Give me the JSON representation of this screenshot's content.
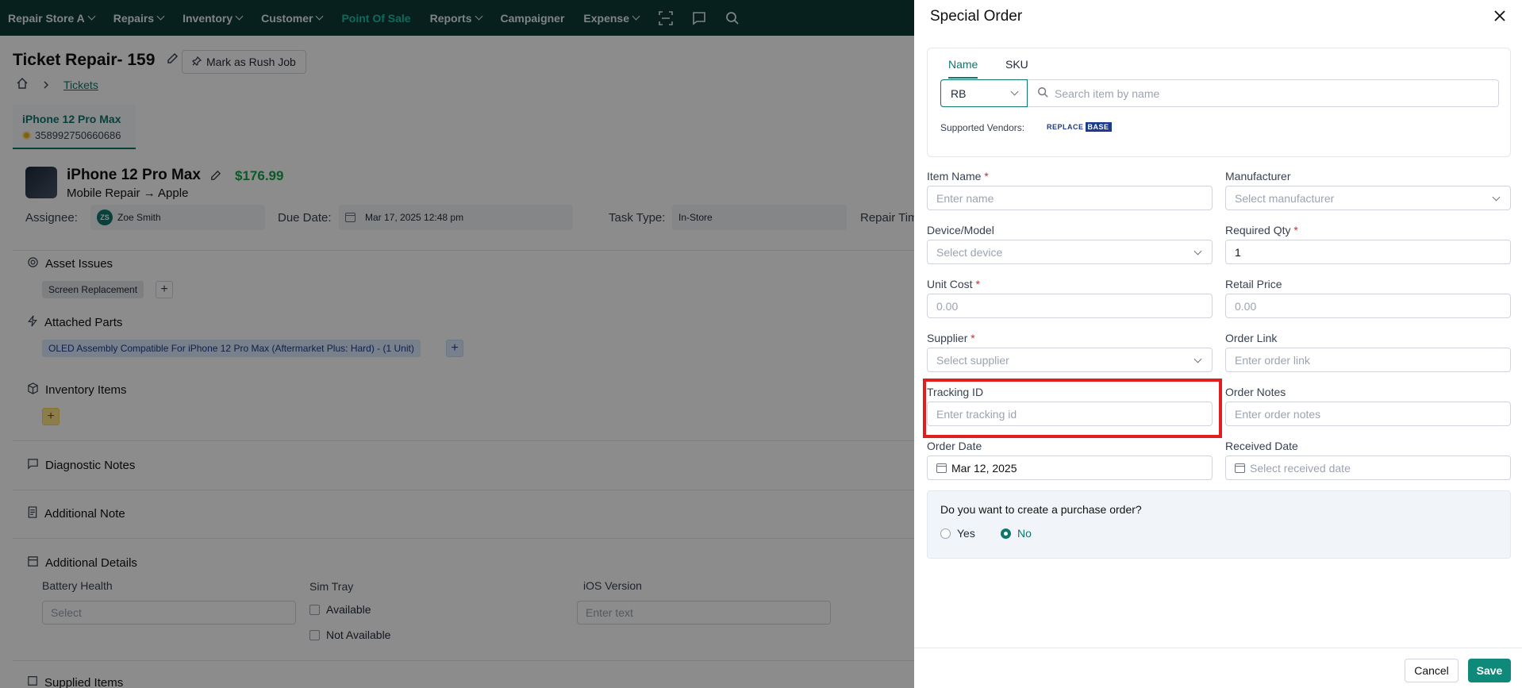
{
  "topnav": {
    "items": [
      {
        "label": "Repair Store A",
        "dropdown": true
      },
      {
        "label": "Repairs",
        "dropdown": true
      },
      {
        "label": "Inventory",
        "dropdown": true
      },
      {
        "label": "Customer",
        "dropdown": true
      },
      {
        "label": "Point Of Sale",
        "dropdown": false,
        "active": true
      },
      {
        "label": "Reports",
        "dropdown": true
      },
      {
        "label": "Campaigner",
        "dropdown": false
      },
      {
        "label": "Expense",
        "dropdown": true
      }
    ],
    "icons": [
      "scan-icon",
      "message-icon",
      "search-icon"
    ],
    "active_color": "#19c2a6",
    "bg_color": "#0e3b38"
  },
  "ticket": {
    "title": "Ticket Repair- 159",
    "rush_label": "Mark as Rush Job",
    "breadcrumb": "Tickets",
    "device_tab": {
      "name": "iPhone 12 Pro Max",
      "imei": "358992750660686"
    },
    "device_name": "iPhone 12 Pro Max",
    "price": "$176.99",
    "subtitle": "Mobile Repair → Apple",
    "assignee_label": "Assignee:",
    "assignee_initials": "ZS",
    "assignee_name": "Zoe Smith",
    "due_label": "Due Date:",
    "due_value": "Mar 17, 2025 12:48 pm",
    "task_label": "Task Type:",
    "task_value": "In-Store",
    "repair_time_label": "Repair Tim",
    "sections": {
      "asset_issues": "Asset Issues",
      "issue_chip": "Screen Replacement",
      "attached_parts": "Attached Parts",
      "part_chip": "OLED Assembly Compatible For iPhone 12 Pro Max (Aftermarket Plus: Hard) - (1 Unit)",
      "inventory_items": "Inventory Items",
      "diagnostic_notes": "Diagnostic Notes",
      "additional_note": "Additional Note",
      "additional_details": "Additional Details",
      "supplied_items": "Supplied Items"
    },
    "details": {
      "battery_label": "Battery Health",
      "battery_placeholder": "Select",
      "sim_label": "Sim Tray",
      "sim_opt1": "Available",
      "sim_opt2": "Not Available",
      "ios_label": "iOS Version",
      "ios_placeholder": "Enter text"
    }
  },
  "drawer": {
    "title": "Special Order",
    "tabs": [
      {
        "label": "Name",
        "active": true
      },
      {
        "label": "SKU",
        "active": false
      }
    ],
    "vendor_value": "RB",
    "search_placeholder": "Search item by name",
    "supported_label": "Supported Vendors:",
    "vendor_logo_a": "REPLACE",
    "vendor_logo_b": "BASE",
    "fields": {
      "item_name": {
        "label": "Item Name",
        "placeholder": "Enter name"
      },
      "manufacturer": {
        "label": "Manufacturer",
        "placeholder": "Select manufacturer"
      },
      "device": {
        "label": "Device/Model",
        "placeholder": "Select device"
      },
      "qty": {
        "label": "Required Qty",
        "value": "1"
      },
      "unit_cost": {
        "label": "Unit Cost",
        "placeholder": "0.00"
      },
      "retail_price": {
        "label": "Retail Price",
        "placeholder": "0.00"
      },
      "supplier": {
        "label": "Supplier",
        "placeholder": "Select supplier"
      },
      "order_link": {
        "label": "Order Link",
        "placeholder": "Enter order link"
      },
      "tracking": {
        "label": "Tracking ID",
        "placeholder": "Enter tracking id"
      },
      "order_notes": {
        "label": "Order Notes",
        "placeholder": "Enter order notes"
      },
      "order_date": {
        "label": "Order Date",
        "value": "Mar 12, 2025"
      },
      "received_date": {
        "label": "Received Date",
        "placeholder": "Select received date"
      }
    },
    "required_mark": "*",
    "po_question": "Do you want to create a purchase order?",
    "po_yes": "Yes",
    "po_no": "No",
    "po_selected": "No",
    "cancel_label": "Cancel",
    "save_label": "Save",
    "accent_color": "#0f766e",
    "highlight_color": "#e01e1e"
  }
}
